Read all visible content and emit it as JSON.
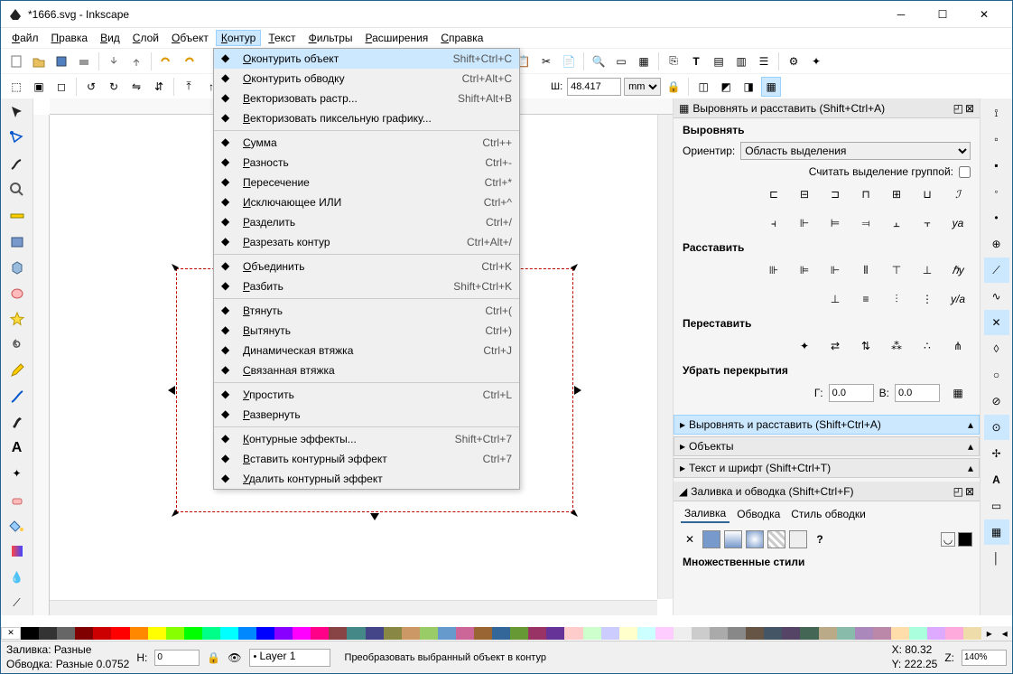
{
  "title": "*1666.svg - Inkscape",
  "menu": [
    "Файл",
    "Правка",
    "Вид",
    "Слой",
    "Объект",
    "Контур",
    "Текст",
    "Фильтры",
    "Расширения",
    "Справка"
  ],
  "menu_active_index": 5,
  "dropdown": [
    {
      "label": "Оконтурить объект",
      "short": "Shift+Ctrl+C",
      "hl": true
    },
    {
      "label": "Оконтурить обводку",
      "short": "Ctrl+Alt+C"
    },
    {
      "label": "Векторизовать растр...",
      "short": "Shift+Alt+B"
    },
    {
      "label": "Векторизовать пиксельную графику..."
    },
    {
      "sep": true
    },
    {
      "label": "Сумма",
      "short": "Ctrl++"
    },
    {
      "label": "Разность",
      "short": "Ctrl+-"
    },
    {
      "label": "Пересечение",
      "short": "Ctrl+*"
    },
    {
      "label": "Исключающее ИЛИ",
      "short": "Ctrl+^"
    },
    {
      "label": "Разделить",
      "short": "Ctrl+/"
    },
    {
      "label": "Разрезать контур",
      "short": "Ctrl+Alt+/"
    },
    {
      "sep": true
    },
    {
      "label": "Объединить",
      "short": "Ctrl+K"
    },
    {
      "label": "Разбить",
      "short": "Shift+Ctrl+K"
    },
    {
      "sep": true
    },
    {
      "label": "Втянуть",
      "short": "Ctrl+("
    },
    {
      "label": "Вытянуть",
      "short": "Ctrl+)"
    },
    {
      "label": "Динамическая втяжка",
      "short": "Ctrl+J"
    },
    {
      "label": "Связанная втяжка"
    },
    {
      "sep": true
    },
    {
      "label": "Упростить",
      "short": "Ctrl+L"
    },
    {
      "label": "Развернуть"
    },
    {
      "sep": true
    },
    {
      "label": "Контурные эффекты...",
      "short": "Shift+Ctrl+7"
    },
    {
      "label": "Вставить контурный эффект",
      "short": "Ctrl+7"
    },
    {
      "label": "Удалить контурный эффект"
    }
  ],
  "toolbar2": {
    "w_label": "Ш:",
    "w_val": "48.417",
    "unit": "mm"
  },
  "align_panel": {
    "title": "Выровнять и расставить (Shift+Ctrl+A)",
    "sec_align": "Выровнять",
    "orient_label": "Ориентир:",
    "orient_value": "Область выделения",
    "group_label": "Считать выделение группой:",
    "sec_dist": "Расставить",
    "sec_rearrange": "Переставить",
    "sec_overlap": "Убрать перекрытия",
    "h_label": "Г:",
    "h_val": "0.0",
    "v_label": "В:",
    "v_val": "0.0"
  },
  "collapsers": [
    {
      "label": "Выровнять и расставить (Shift+Ctrl+A)",
      "sel": true
    },
    {
      "label": "Объекты"
    },
    {
      "label": "Текст и шрифт (Shift+Ctrl+T)"
    }
  ],
  "fill_panel": {
    "title": "Заливка и обводка (Shift+Ctrl+F)",
    "tabs": [
      "Заливка",
      "Обводка",
      "Стиль обводки"
    ],
    "multi": "Множественные стили"
  },
  "status": {
    "fill_label": "Заливка:",
    "fill_val": "Разные",
    "stroke_label": "Обводка:",
    "stroke_val": "Разные 0.0752",
    "h_label": "Н:",
    "h_val": "0",
    "layer": "Layer 1",
    "hint": "Преобразовать выбранный объект в контур",
    "x_label": "X:",
    "x_val": "80.32",
    "y_label": "Y:",
    "y_val": "222.25",
    "z_label": "Z:",
    "z_val": "140%"
  },
  "palette_colors": [
    "#000",
    "#333",
    "#666",
    "#800000",
    "#c00",
    "#f00",
    "#f80",
    "#ff0",
    "#8f0",
    "#0f0",
    "#0f8",
    "#0ff",
    "#08f",
    "#00f",
    "#80f",
    "#f0f",
    "#f08",
    "#844",
    "#488",
    "#448",
    "#884",
    "#c96",
    "#9c6",
    "#69c",
    "#c69",
    "#963",
    "#369",
    "#693",
    "#936",
    "#639",
    "#fcc",
    "#cfc",
    "#ccf",
    "#ffc",
    "#cff",
    "#fcf",
    "#eee",
    "#ccc",
    "#aaa",
    "#888",
    "#654",
    "#456",
    "#546",
    "#465",
    "#ba8",
    "#8ba",
    "#a8b",
    "#b8a",
    "#fda",
    "#afd",
    "#daf",
    "#fad",
    "#eda"
  ]
}
